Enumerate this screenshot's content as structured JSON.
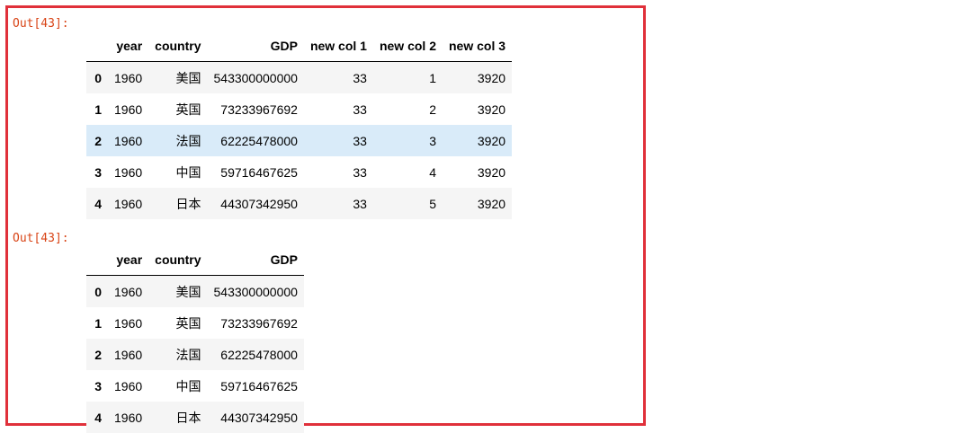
{
  "outputs": [
    {
      "prompt": "Out[43]:",
      "columns": [
        "year",
        "country",
        "GDP",
        "new col 1",
        "new col 2",
        "new col 3"
      ],
      "rows": [
        {
          "index": "0",
          "cells": [
            "1960",
            "美国",
            "543300000000",
            "33",
            "1",
            "3920"
          ]
        },
        {
          "index": "1",
          "cells": [
            "1960",
            "英国",
            "73233967692",
            "33",
            "2",
            "3920"
          ]
        },
        {
          "index": "2",
          "cells": [
            "1960",
            "法国",
            "62225478000",
            "33",
            "3",
            "3920"
          ]
        },
        {
          "index": "3",
          "cells": [
            "1960",
            "中国",
            "59716467625",
            "33",
            "4",
            "3920"
          ]
        },
        {
          "index": "4",
          "cells": [
            "1960",
            "日本",
            "44307342950",
            "33",
            "5",
            "3920"
          ]
        }
      ]
    },
    {
      "prompt": "Out[43]:",
      "columns": [
        "year",
        "country",
        "GDP"
      ],
      "rows": [
        {
          "index": "0",
          "cells": [
            "1960",
            "美国",
            "543300000000"
          ]
        },
        {
          "index": "1",
          "cells": [
            "1960",
            "英国",
            "73233967692"
          ]
        },
        {
          "index": "2",
          "cells": [
            "1960",
            "法国",
            "62225478000"
          ]
        },
        {
          "index": "3",
          "cells": [
            "1960",
            "中国",
            "59716467625"
          ]
        },
        {
          "index": "4",
          "cells": [
            "1960",
            "日本",
            "44307342950"
          ]
        }
      ]
    }
  ],
  "highlighted_row": {
    "output": 0,
    "row": 2
  },
  "colors": {
    "frame_border": "#e0303a",
    "prompt": "#d84315",
    "row_stripe": "#f5f5f5",
    "row_hover": "#d9ebf9"
  }
}
